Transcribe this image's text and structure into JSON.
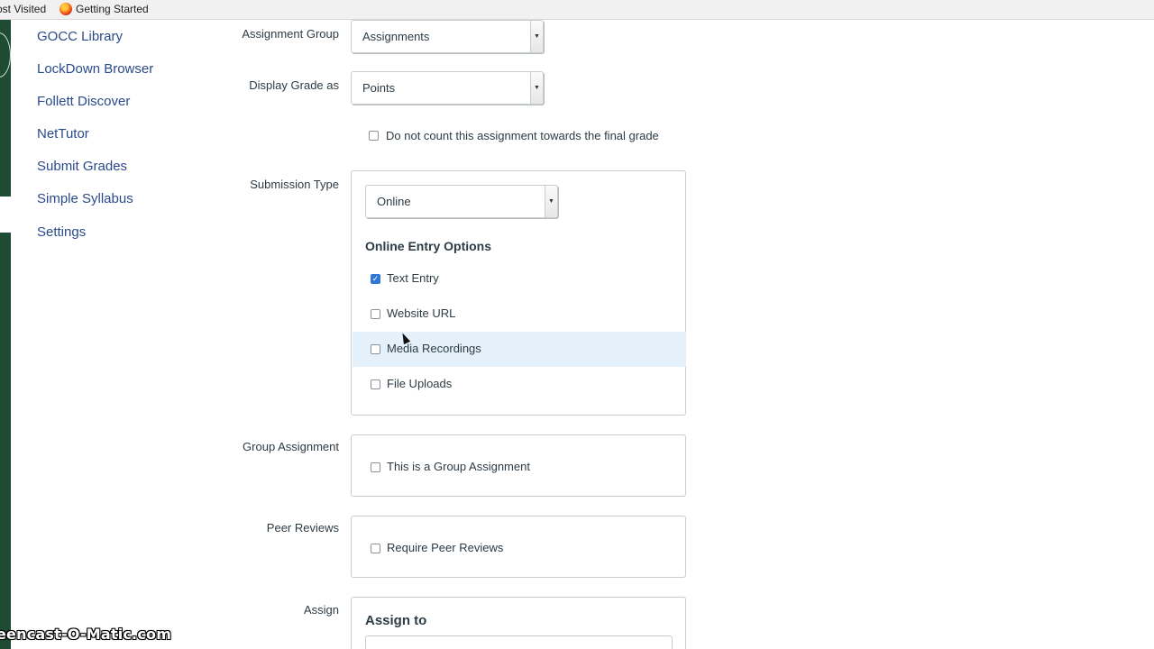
{
  "bookmarks": {
    "most_visited": "ost Visited",
    "getting_started": "Getting Started"
  },
  "course_nav": {
    "items": [
      {
        "label": "GOCC Library"
      },
      {
        "label": "LockDown Browser"
      },
      {
        "label": "Follett Discover"
      },
      {
        "label": "NetTutor"
      },
      {
        "label": "Submit Grades"
      },
      {
        "label": "Simple Syllabus"
      },
      {
        "label": "Settings"
      }
    ]
  },
  "form": {
    "assignment_group": {
      "label": "Assignment Group",
      "value": "Assignments"
    },
    "display_grade": {
      "label": "Display Grade as",
      "value": "Points"
    },
    "no_count": {
      "label": "Do not count this assignment towards the final grade",
      "checked": false
    },
    "submission_type": {
      "label": "Submission Type",
      "value": "Online",
      "entry_options_heading": "Online Entry Options",
      "options": [
        {
          "label": "Text Entry",
          "checked": true
        },
        {
          "label": "Website URL",
          "checked": false
        },
        {
          "label": "Media Recordings",
          "checked": false
        },
        {
          "label": "File Uploads",
          "checked": false
        }
      ]
    },
    "group_assignment": {
      "label": "Group Assignment",
      "option": "This is a Group Assignment",
      "checked": false
    },
    "peer_reviews": {
      "label": "Peer Reviews",
      "option": "Require Peer Reviews",
      "checked": false
    },
    "assign": {
      "label": "Assign",
      "heading": "Assign to"
    }
  },
  "watermark": "eencast-O-Matic.com",
  "colors": {
    "nav_green": "#1f4a33",
    "link_blue": "#2b4a8b",
    "checkbox_blue": "#2f78d6",
    "hover_row": "#e4f1fb"
  }
}
